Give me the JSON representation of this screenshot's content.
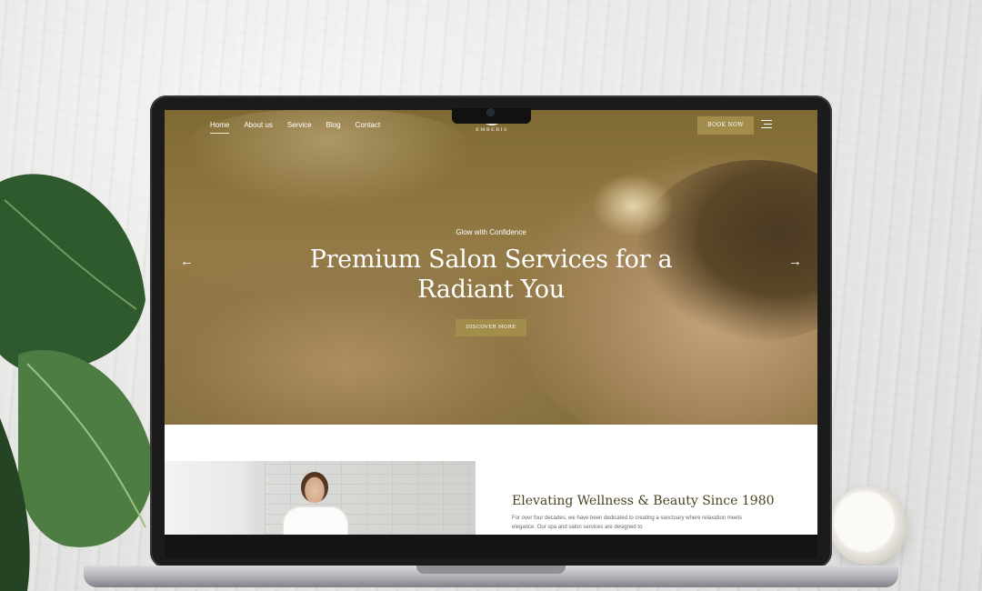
{
  "site": {
    "logo_text": "EMBERIS",
    "nav": [
      {
        "label": "Home",
        "active": true
      },
      {
        "label": "About us",
        "active": false
      },
      {
        "label": "Service",
        "active": false
      },
      {
        "label": "Blog",
        "active": false
      },
      {
        "label": "Contact",
        "active": false
      }
    ],
    "book_button": "BOOK NOW",
    "menu_icon": "hamburger-menu-icon"
  },
  "hero": {
    "eyebrow": "Glow with Confidence",
    "headline_line1": "Premium Salon Services for a",
    "headline_line2": "Radiant You",
    "cta": "DISCOVER MORE",
    "prev_arrow": "←",
    "next_arrow": "→",
    "overlay_color": "#8a7238"
  },
  "about": {
    "title": "Elevating Wellness & Beauty Since 1980",
    "text": "For over four decades, we have been dedicated to creating a sanctuary where relaxation meets elegance. Our spa and salon services are designed to"
  },
  "colors": {
    "accent": "#a28d4d",
    "title_text": "#4a4220"
  }
}
